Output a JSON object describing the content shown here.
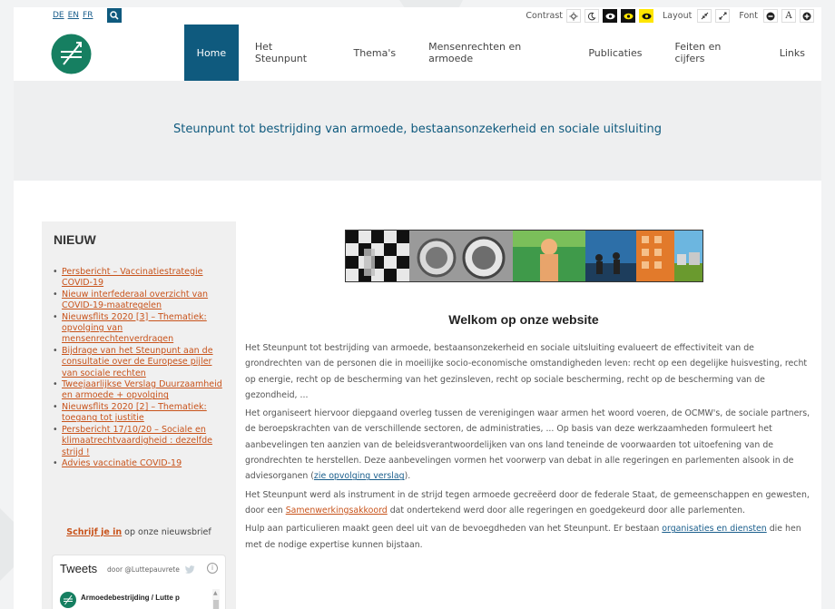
{
  "languages": [
    "DE",
    "EN",
    "FR"
  ],
  "util": {
    "contrast_label": "Contrast",
    "layout_label": "Layout",
    "font_label": "Font",
    "font_a": "A"
  },
  "icons": {
    "search": "search-icon",
    "sun": "sun-icon",
    "moon": "moon-icon",
    "eye": "eye-icon",
    "shrink": "shrink-icon",
    "expand": "expand-icon",
    "minus": "minus-icon",
    "plus": "plus-icon",
    "logo": "logo-icon",
    "twitter": "twitter-icon",
    "info": "info-icon"
  },
  "colors": {
    "brand": "#0f5a7e",
    "logo": "#167f61",
    "link_orange": "#c8531b",
    "highlight_yellow": "#ffe600"
  },
  "nav": [
    {
      "label": "Home",
      "active": true
    },
    {
      "label": "Het Steunpunt"
    },
    {
      "label": "Thema's"
    },
    {
      "label": "Mensenrechten en armoede"
    },
    {
      "label": "Publicaties"
    },
    {
      "label": "Feiten en cijfers"
    },
    {
      "label": "Links"
    }
  ],
  "tagline": "Steunpunt tot bestrijding van armoede, bestaansonzekerheid en sociale uitsluiting",
  "sidebar": {
    "title": "NIEUW",
    "news": [
      [
        "Persbericht – Vaccinatiestrategie",
        "COVID-19"
      ],
      [
        "Nieuw interfederaal overzicht van",
        "COVID-19-maatregelen"
      ],
      [
        "Nieuwsflits 2020 [3] – Thematiek:",
        "opvolging van",
        "mensenrechtenverdragen"
      ],
      [
        "Bijdrage van het Steunpunt aan de",
        "consultatie over de Europese pijler",
        "van sociale rechten"
      ],
      [
        "Tweejaarlijkse Verslag Duurzaamheid",
        "en armoede + opvolging"
      ],
      [
        "Nieuwsflits 2020 [2] – Thematiek:",
        "toegang tot justitie"
      ],
      [
        "Persbericht 17/10/20 – Sociale en",
        "klimaatrechtvaardigheid : dezelfde",
        "strijd !"
      ],
      [
        "Advies vaccinatie COVID-19"
      ]
    ],
    "subscribe_link": "Schrijf je in",
    "subscribe_rest": " op onze nieuwsbrief",
    "tweets_title": "Tweets",
    "tweets_by": "door @Luttepauvrete",
    "tweets_info": "i",
    "tweet_account": "Armoedebestrijding / Lutte p"
  },
  "main": {
    "title": "Welkom op onze website",
    "p1": "Het Steunpunt tot bestrijding van armoede, bestaansonzekerheid en sociale uitsluiting evalueert de effectiviteit van de grondrechten van de personen die in moeilijke socio-economische omstandigheden leven: recht op een degelijke huisvesting, recht op energie, recht op de bescherming van het gezinsleven, recht op sociale bescherming, recht op de bescherming van de gezondheid, ...",
    "p2_a": "Het organiseert hiervoor diepgaand overleg tussen de verenigingen waar armen het woord voeren, de OCMW's, de sociale partners, de beroepskrachten van de verschillende sectoren, de administraties, ... Op basis van deze werkzaamheden formuleert het aanbevelingen ten aanzien van de beleidsverantwoordelijken van ons land teneinde de voorwaarden tot uitoefening van de grondrechten te herstellen. Deze aanbevelingen vormen het voorwerp van debat in alle regeringen en parlementen alsook in de adviesorganen (",
    "p2_link": "zie opvolging verslag",
    "p2_b": ").",
    "p3_a": "Het Steunpunt werd als instrument in de strijd tegen armoede gecreëerd door de federale Staat, de gemeenschappen en gewesten, door een ",
    "p3_link": "Samenwerkingsakkoord",
    "p3_b": " dat ondertekend werd door alle regeringen en goedgekeurd door alle parlementen.",
    "p4_a": "Hulp aan particulieren maakt geen deel uit van de bevoegdheden van het Steunpunt. Er bestaan ",
    "p4_link": "organisaties en diensten",
    "p4_b": " die hen met de nodige expertise kunnen bijstaan."
  }
}
